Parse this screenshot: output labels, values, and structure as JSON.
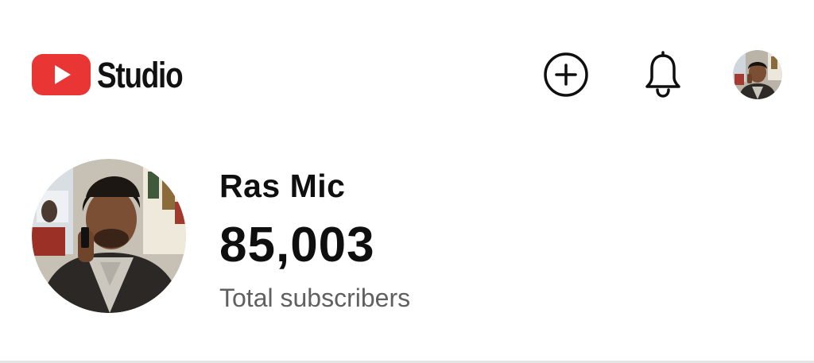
{
  "header": {
    "logo": {
      "text": "Studio",
      "icon": "youtube-play-logo-icon",
      "brand_color": "#ff0000"
    },
    "actions": [
      {
        "icon": "create-plus-circle-icon"
      },
      {
        "icon": "notifications-bell-icon"
      },
      {
        "icon": "account-avatar"
      }
    ]
  },
  "channel": {
    "name": "Ras Mic",
    "subscriber_count": "85,003",
    "subscriber_label": "Total subscribers"
  },
  "colors": {
    "background": "#ffffff",
    "primary_text": "#0f0f0f",
    "secondary_text": "#606060",
    "brand_red": "#ff0000"
  }
}
